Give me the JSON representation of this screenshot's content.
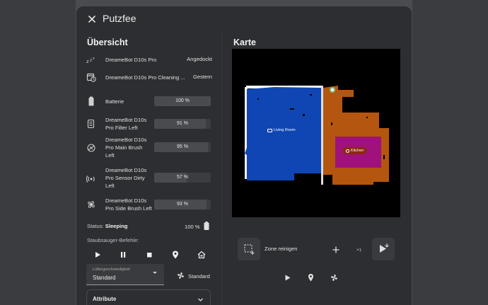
{
  "dialog": {
    "title": "Putzfee"
  },
  "overview": {
    "title": "Übersicht",
    "rows": [
      {
        "label": "DreameBot D10s Pro",
        "value": "Angedockt",
        "icon": "robot-vacuum-zzz-icon"
      },
      {
        "label": "DreameBot D10s Pro Cleaning ...",
        "value": "Gestern",
        "icon": "calendar-clock-icon"
      },
      {
        "label": "Batterie",
        "bar": "100 %",
        "level": 100,
        "icon": "battery-icon"
      },
      {
        "label_lines": [
          "DreameBot D10s",
          "Pro Filter Left"
        ],
        "bar": "91 %",
        "level": 91,
        "icon": "filter-icon"
      },
      {
        "label_lines": [
          "DreameBot D10s",
          "Pro Main Brush",
          "Left"
        ],
        "bar": "95 %",
        "level": 95,
        "icon": "brush-icon"
      },
      {
        "label_lines": [
          "DreameBot D10s",
          "Pro Sensor Dirty",
          "Left"
        ],
        "bar": "57 %",
        "level": 57,
        "icon": "sensor-icon"
      },
      {
        "label_lines": [
          "DreameBot D10s",
          "Pro Side Brush Left"
        ],
        "bar": "93 %",
        "level": 93,
        "icon": "side-brush-icon"
      }
    ],
    "status_prefix": "Status:",
    "status_value": "Sleeping",
    "battery_pct": "100 %",
    "commands_label": "Staubsauger-Befehle:",
    "commands": [
      "play-icon",
      "pause-icon",
      "stop-icon",
      "locate-icon",
      "return-home-icon"
    ],
    "fan_speed": {
      "caption": "Lüftergeschwindigkeit",
      "value": "Standard",
      "chip_label": "Standard"
    },
    "attributes_label": "Attribute"
  },
  "map": {
    "title": "Karte",
    "rooms": [
      {
        "name": "Living Room",
        "color": "#0f46b4"
      },
      {
        "name": "Kitchen",
        "color": "#a0117d"
      }
    ],
    "hall_color": "#b4560f",
    "zone_label": "Zone reinigen",
    "repeat_label": "×1",
    "commands": [
      "play-icon",
      "locate-icon",
      "fan-icon"
    ]
  },
  "colors": {
    "dialog_bg": "#2d2e31",
    "accent_blue": "#0f46b4",
    "accent_orange": "#b4560f",
    "accent_magenta": "#a0117d"
  }
}
